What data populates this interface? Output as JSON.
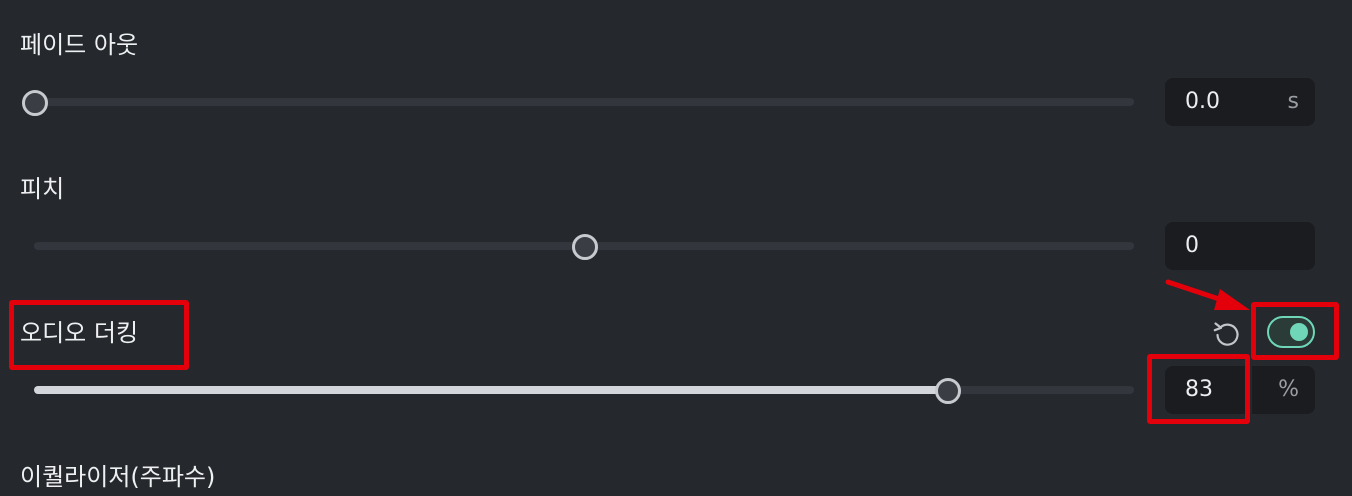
{
  "fade_out": {
    "label": "페이드 아웃",
    "value": "0.0",
    "unit": "s",
    "slider_position": 0.0
  },
  "pitch": {
    "label": "피치",
    "value": "0",
    "slider_position": 0.5
  },
  "audio_ducking": {
    "label": "오디오 더킹",
    "value": "83",
    "unit": "%",
    "slider_position": 0.83,
    "toggle_enabled": true
  },
  "equalizer": {
    "label": "이퀄라이저(주파수)"
  },
  "icons": {
    "reset": "reset-icon",
    "toggle": "toggle-switch"
  },
  "colors": {
    "background": "#25282d",
    "accent": "#6fd7b7",
    "annotation": "#e3000b"
  }
}
